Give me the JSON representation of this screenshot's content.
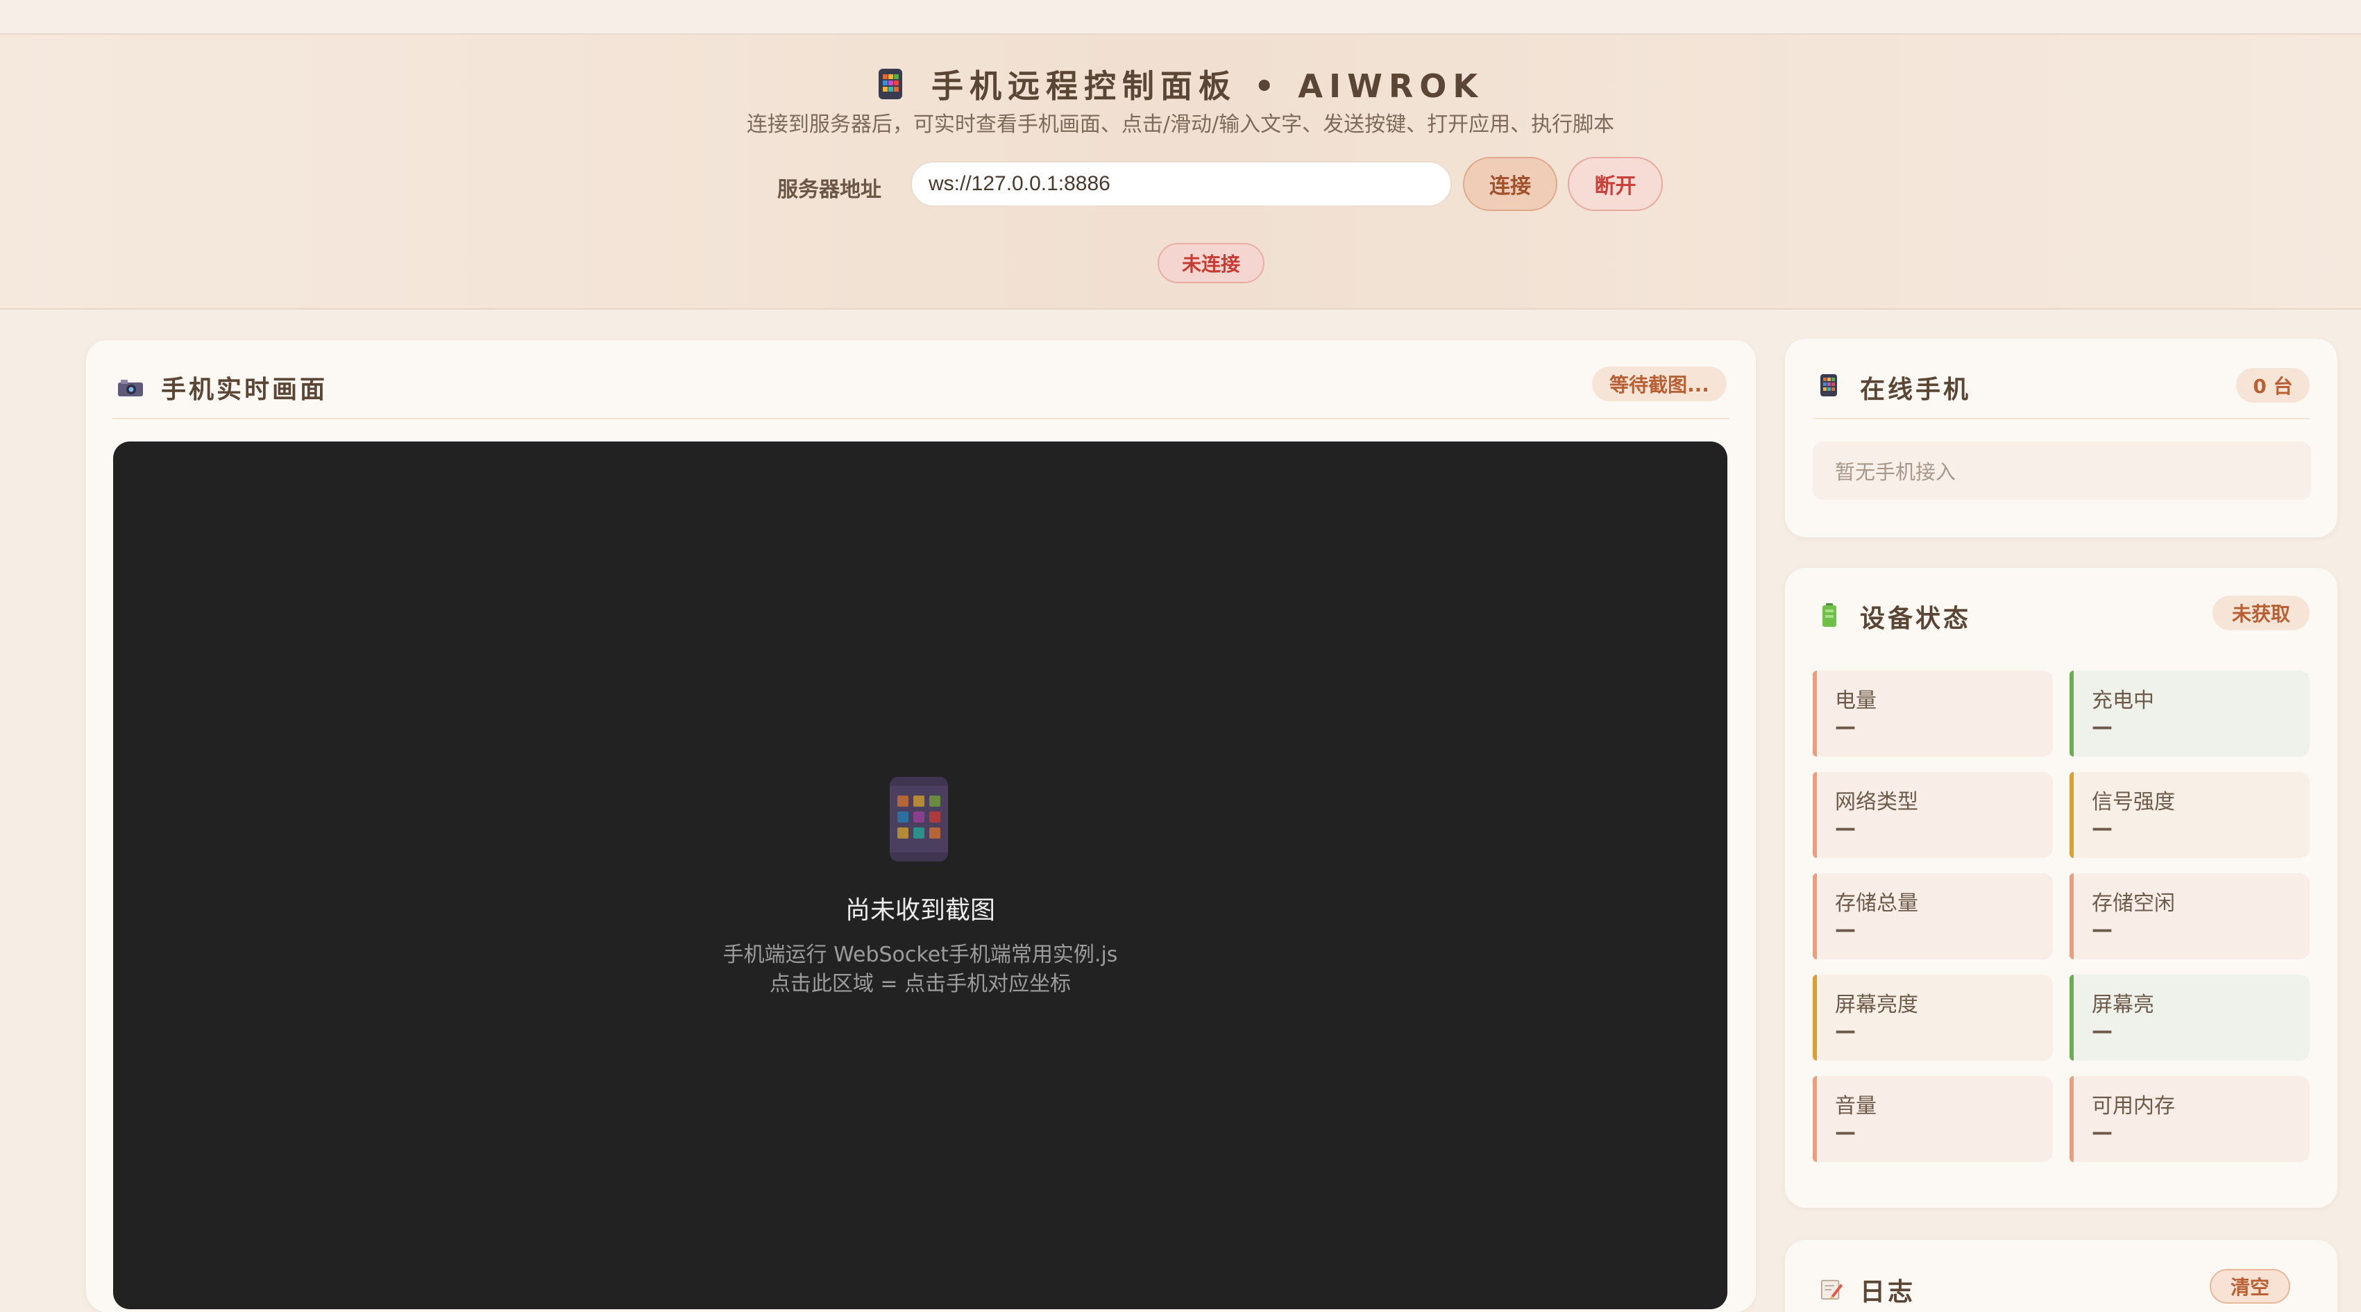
{
  "header": {
    "title": "手机远程控制面板 • AIWROK",
    "subtitle": "连接到服务器后，可实时查看手机画面、点击/滑动/输入文字、发送按键、打开应用、执行脚本",
    "server_label": "服务器地址",
    "server_value": "ws://127.0.0.1:8886",
    "connect_label": "连接",
    "disconnect_label": "断开",
    "status": "未连接"
  },
  "screen_panel": {
    "title": "手机实时画面",
    "badge": "等待截图...",
    "placeholder_title": "尚未收到截图",
    "hint_line1": "手机端运行 WebSocket手机端常用实例.js",
    "hint_line2": "点击此区域 = 点击手机对应坐标"
  },
  "online_panel": {
    "title": "在线手机",
    "count": "0 台",
    "empty_text": "暂无手机接入"
  },
  "device_panel": {
    "title": "设备状态",
    "badge": "未获取",
    "stats": [
      {
        "label": "电量",
        "value": "—",
        "color": "#e99f7d"
      },
      {
        "label": "充电中",
        "value": "—",
        "color": "#6aac52"
      },
      {
        "label": "网络类型",
        "value": "—",
        "color": "#e99f7d"
      },
      {
        "label": "信号强度",
        "value": "—",
        "color": "#d8a032"
      },
      {
        "label": "存储总量",
        "value": "—",
        "color": "#e99f7d"
      },
      {
        "label": "存储空闲",
        "value": "—",
        "color": "#e99f7d"
      },
      {
        "label": "屏幕亮度",
        "value": "—",
        "color": "#d8a032"
      },
      {
        "label": "屏幕亮",
        "value": "—",
        "color": "#6aac52"
      },
      {
        "label": "音量",
        "value": "—",
        "color": "#e99f7d"
      },
      {
        "label": "可用内存",
        "value": "—",
        "color": "#e99f7d"
      }
    ]
  },
  "log_panel": {
    "title": "日志",
    "clear_label": "清空"
  },
  "icons": {
    "title": "phone-icon",
    "screen": "camera-icon",
    "online": "phone-icon",
    "device": "battery-icon",
    "log": "memo-icon"
  }
}
